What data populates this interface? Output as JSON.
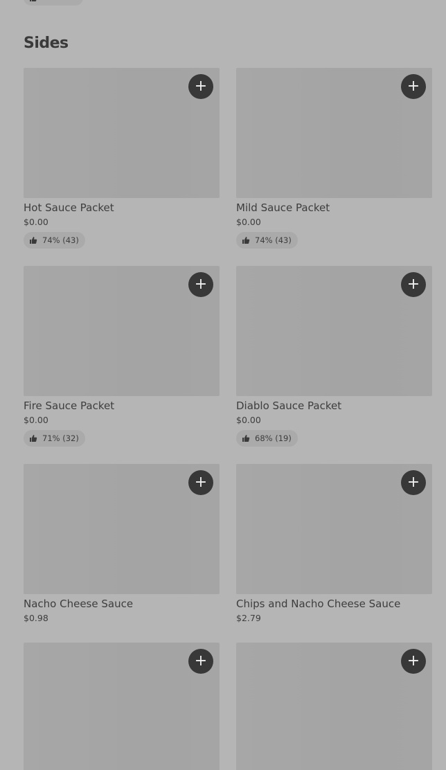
{
  "section": {
    "title": "Sides"
  },
  "items": [
    {
      "name": "Hot Sauce Packet",
      "price": "$0.00",
      "rating": "74% (43)"
    },
    {
      "name": "Mild Sauce Packet",
      "price": "$0.00",
      "rating": "74% (43)"
    },
    {
      "name": "Fire Sauce Packet",
      "price": "$0.00",
      "rating": "71% (32)"
    },
    {
      "name": "Diablo Sauce Packet",
      "price": "$0.00",
      "rating": "68% (19)"
    },
    {
      "name": "Nacho Cheese Sauce",
      "price": "$0.98",
      "rating": ""
    },
    {
      "name": "Chips and Nacho Cheese Sauce",
      "price": "$2.79",
      "rating": ""
    },
    {
      "name": "",
      "price": "",
      "rating": ""
    },
    {
      "name": "",
      "price": "",
      "rating": ""
    }
  ],
  "icons": {
    "add": "plus-icon",
    "rating": "thumbs-up-icon"
  },
  "colors": {
    "background": "#b5b5b5",
    "add_button": "#383838",
    "image_placeholder": "#a5a5a5"
  }
}
